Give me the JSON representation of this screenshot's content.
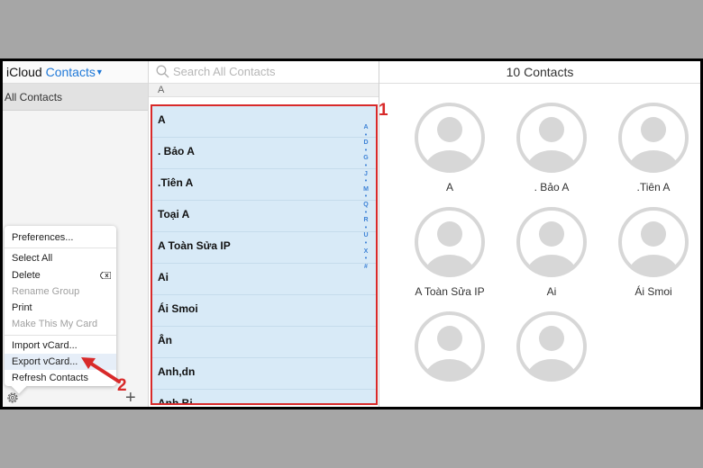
{
  "header": {
    "icloud": "iCloud",
    "contacts": "Contacts",
    "chevron_icon": "chevron-down-icon"
  },
  "sidebar": {
    "group": "All Contacts"
  },
  "menu": {
    "items": [
      {
        "label": "Preferences...",
        "enabled": true
      },
      {
        "label": "Select All",
        "enabled": true
      },
      {
        "label": "Delete",
        "enabled": true,
        "icon": "delete-key-icon"
      },
      {
        "label": "Rename Group",
        "enabled": false
      },
      {
        "label": "Print",
        "enabled": true
      },
      {
        "label": "Make This My Card",
        "enabled": false
      },
      {
        "label": "Import vCard...",
        "enabled": true
      },
      {
        "label": "Export vCard...",
        "enabled": true,
        "highlighted": true
      },
      {
        "label": "Refresh Contacts",
        "enabled": true
      }
    ]
  },
  "search": {
    "placeholder": "Search All Contacts"
  },
  "list": {
    "section": "A",
    "contacts": [
      "A",
      ". Bảo A",
      ".Tiên A",
      "Toại A",
      "A Toàn Sửa IP",
      "Ai",
      "Ái Smoi",
      "Ân",
      "Anh,dn",
      "Anh Bi"
    ],
    "index": [
      "A",
      "•",
      "D",
      "•",
      "G",
      "•",
      "J",
      "•",
      "M",
      "•",
      "Q",
      "•",
      "R",
      "•",
      "U",
      "•",
      "X",
      "•",
      "#"
    ]
  },
  "detail": {
    "count_label": "10 Contacts",
    "cards": [
      "A",
      ". Bảo A",
      ".Tiên A",
      "A Toàn Sửa IP",
      "Ai",
      "Ái Smoi",
      "",
      ""
    ]
  },
  "annotations": {
    "box_number": "1",
    "arrow_number": "2"
  },
  "colors": {
    "accent": "#2079d8",
    "highlight": "#d82a2a",
    "selection": "#d8eaf7"
  }
}
